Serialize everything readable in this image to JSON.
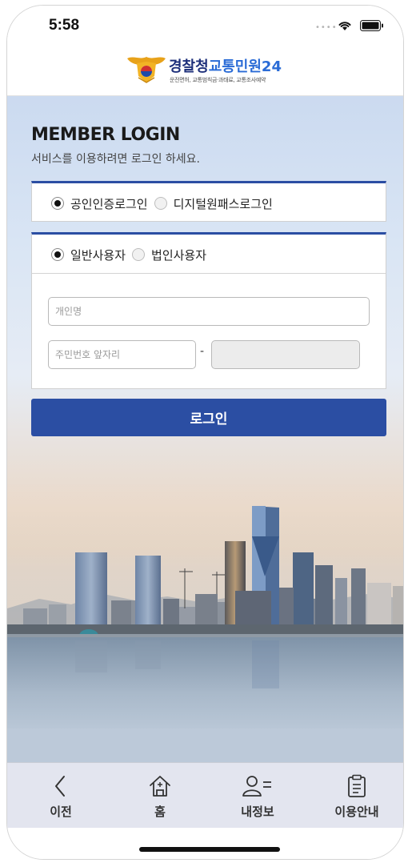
{
  "status_bar": {
    "time": "5:58",
    "signal_icon": "cellular-dots-icon",
    "wifi_icon": "wifi-icon",
    "battery_icon": "battery-icon"
  },
  "header": {
    "logo_icon": "police-emblem-icon",
    "title_main": "경찰청",
    "title_sub": "교통민원24",
    "tagline": "운전면허, 교통범칙금·과태료, 교통조사예약"
  },
  "login": {
    "title": "MEMBER LOGIN",
    "subtitle": "서비스를 이용하려면 로그인 하세요.",
    "cert_options": [
      {
        "label": "공인인증로그인",
        "selected": true
      },
      {
        "label": "디지털원패스로그인",
        "selected": false
      }
    ],
    "user_types": [
      {
        "label": "일반사용자",
        "selected": true
      },
      {
        "label": "법인사용자",
        "selected": false
      }
    ],
    "name_placeholder": "개인명",
    "rrn_front_placeholder": "주민번호 앞자리",
    "rrn_separator": "-",
    "button_label": "로그인"
  },
  "bottom_nav": [
    {
      "label": "이전",
      "icon": "chevron-left-icon"
    },
    {
      "label": "홈",
      "icon": "home-icon"
    },
    {
      "label": "내정보",
      "icon": "user-info-icon"
    },
    {
      "label": "이용안내",
      "icon": "clipboard-icon"
    }
  ],
  "colors": {
    "accent": "#2b4ea3",
    "nav_background": "#e3e5ef"
  }
}
